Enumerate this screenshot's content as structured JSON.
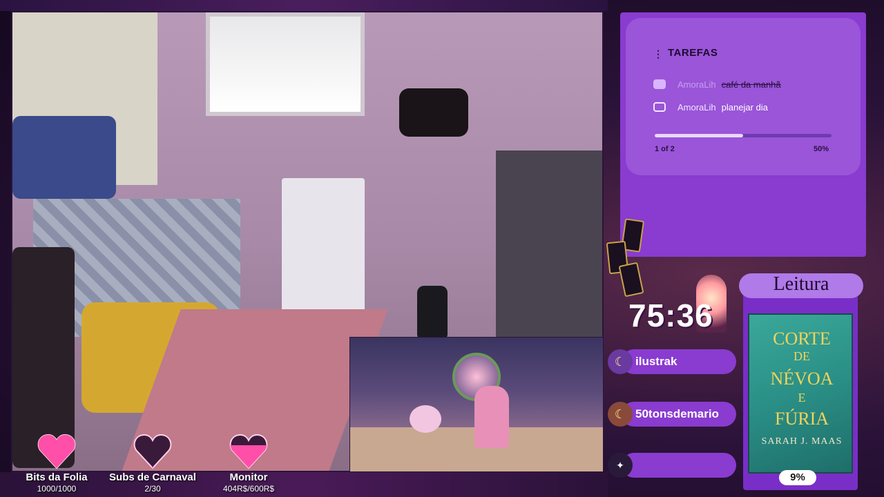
{
  "tasks": {
    "title": "TAREFAS",
    "items": [
      {
        "user": "AmoraLih",
        "text": "café da manhã",
        "done": true
      },
      {
        "user": "AmoraLih",
        "text": "planejar dia",
        "done": false
      }
    ],
    "progress_label": "1 of 2",
    "progress_percent_label": "50%",
    "progress_fraction": 0.5
  },
  "timer": "75:36",
  "chat": [
    {
      "name": "ilustrak",
      "icon": "moon-icon"
    },
    {
      "name": "50tonsdemario",
      "icon": "coffee-moon-icon"
    },
    {
      "name": "",
      "icon": "tarot-cards-icon"
    }
  ],
  "reading": {
    "title": "Leitura",
    "book_title_lines": [
      "CORTE",
      "DE",
      "NÉVOA",
      "E",
      "FÚRIA"
    ],
    "author": "SARAH J. MAAS",
    "progress": "9%"
  },
  "goals": [
    {
      "label": "Bits da Folia",
      "value": "1000/1000",
      "fill": 1.0
    },
    {
      "label": "Subs de Carnaval",
      "value": "2/30",
      "fill": 0.067
    },
    {
      "label": "Monitor",
      "value": "404R$/600R$",
      "fill": 0.673
    }
  ],
  "colors": {
    "accent_purple": "#8a3bd0",
    "heart_pink": "#ff4fa8",
    "book_teal": "#2a8f86"
  }
}
